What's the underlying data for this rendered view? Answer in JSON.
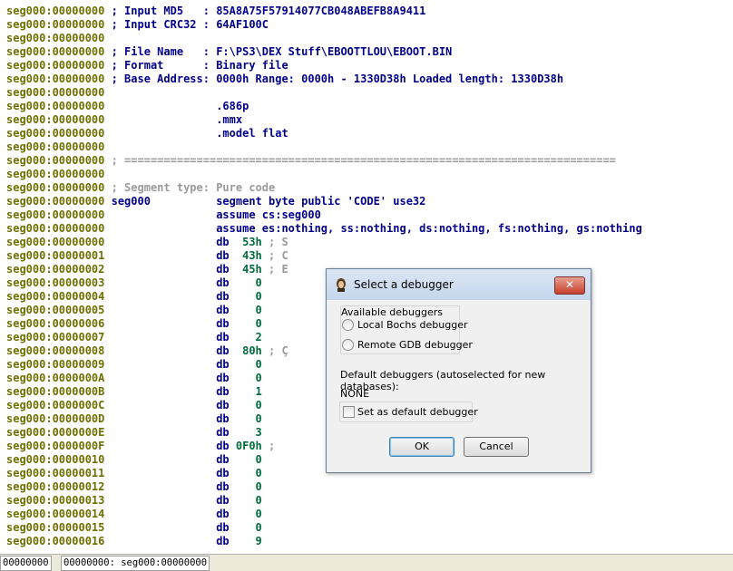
{
  "listing": {
    "lines": [
      {
        "addr": "seg000:00000000",
        "parts": [
          {
            "t": " ; Input MD5   : 85A8A75F57914077CB048ABEFB8A9411",
            "c": "navy"
          }
        ]
      },
      {
        "addr": "seg000:00000000",
        "parts": [
          {
            "t": " ; Input CRC32 : 64AF100C",
            "c": "navy"
          }
        ]
      },
      {
        "addr": "seg000:00000000",
        "parts": []
      },
      {
        "addr": "seg000:00000000",
        "parts": [
          {
            "t": " ; File Name   : F:\\PS3\\DEX Stuff\\EBOOTTLOU\\EBOOT.BIN",
            "c": "navy"
          }
        ]
      },
      {
        "addr": "seg000:00000000",
        "parts": [
          {
            "t": " ; Format      : Binary file",
            "c": "navy"
          }
        ]
      },
      {
        "addr": "seg000:00000000",
        "parts": [
          {
            "t": " ; Base Address: 0000h Range: 0000h - 1330D38h Loaded length: 1330D38h",
            "c": "navy"
          }
        ]
      },
      {
        "addr": "seg000:00000000",
        "parts": []
      },
      {
        "addr": "seg000:00000000",
        "parts": [
          {
            "t": "                 .686p",
            "c": "navy"
          }
        ]
      },
      {
        "addr": "seg000:00000000",
        "parts": [
          {
            "t": "                 .mmx",
            "c": "navy"
          }
        ]
      },
      {
        "addr": "seg000:00000000",
        "parts": [
          {
            "t": "                 .model flat",
            "c": "navy"
          }
        ]
      },
      {
        "addr": "seg000:00000000",
        "parts": []
      },
      {
        "addr": "seg000:00000000",
        "parts": [
          {
            "t": " ; ===========================================================================",
            "c": "grey"
          }
        ]
      },
      {
        "addr": "seg000:00000000",
        "parts": []
      },
      {
        "addr": "seg000:00000000",
        "parts": [
          {
            "t": " ; Segment type: Pure code",
            "c": "grey"
          }
        ]
      },
      {
        "addr": "seg000:00000000",
        "parts": [
          {
            "t": " seg000          segment byte public 'CODE' use32",
            "c": "navy"
          }
        ]
      },
      {
        "addr": "seg000:00000000",
        "parts": [
          {
            "t": "                 assume cs:seg000",
            "c": "navy"
          }
        ]
      },
      {
        "addr": "seg000:00000000",
        "parts": [
          {
            "t": "                 assume es:nothing, ss:nothing, ds:nothing, fs:nothing, gs:nothing",
            "c": "navy"
          }
        ]
      },
      {
        "addr": "seg000:00000000",
        "parts": [
          {
            "t": "                 db  ",
            "c": "navy"
          },
          {
            "t": "53h",
            "c": "green"
          },
          {
            "t": " ; S",
            "c": "grey"
          }
        ]
      },
      {
        "addr": "seg000:00000001",
        "parts": [
          {
            "t": "                 db  ",
            "c": "navy"
          },
          {
            "t": "43h",
            "c": "green"
          },
          {
            "t": " ; C",
            "c": "grey"
          }
        ]
      },
      {
        "addr": "seg000:00000002",
        "parts": [
          {
            "t": "                 db  ",
            "c": "navy"
          },
          {
            "t": "45h",
            "c": "green"
          },
          {
            "t": " ; E",
            "c": "grey"
          }
        ]
      },
      {
        "addr": "seg000:00000003",
        "parts": [
          {
            "t": "                 db    ",
            "c": "navy"
          },
          {
            "t": "0",
            "c": "green"
          }
        ]
      },
      {
        "addr": "seg000:00000004",
        "parts": [
          {
            "t": "                 db    ",
            "c": "navy"
          },
          {
            "t": "0",
            "c": "green"
          }
        ]
      },
      {
        "addr": "seg000:00000005",
        "parts": [
          {
            "t": "                 db    ",
            "c": "navy"
          },
          {
            "t": "0",
            "c": "green"
          }
        ]
      },
      {
        "addr": "seg000:00000006",
        "parts": [
          {
            "t": "                 db    ",
            "c": "navy"
          },
          {
            "t": "0",
            "c": "green"
          }
        ]
      },
      {
        "addr": "seg000:00000007",
        "parts": [
          {
            "t": "                 db    ",
            "c": "navy"
          },
          {
            "t": "2",
            "c": "green"
          }
        ]
      },
      {
        "addr": "seg000:00000008",
        "parts": [
          {
            "t": "                 db  ",
            "c": "navy"
          },
          {
            "t": "80h",
            "c": "green"
          },
          {
            "t": " ; Ç",
            "c": "grey"
          }
        ]
      },
      {
        "addr": "seg000:00000009",
        "parts": [
          {
            "t": "                 db    ",
            "c": "navy"
          },
          {
            "t": "0",
            "c": "green"
          }
        ]
      },
      {
        "addr": "seg000:0000000A",
        "parts": [
          {
            "t": "                 db    ",
            "c": "navy"
          },
          {
            "t": "0",
            "c": "green"
          }
        ]
      },
      {
        "addr": "seg000:0000000B",
        "parts": [
          {
            "t": "                 db    ",
            "c": "navy"
          },
          {
            "t": "1",
            "c": "green"
          }
        ]
      },
      {
        "addr": "seg000:0000000C",
        "parts": [
          {
            "t": "                 db    ",
            "c": "navy"
          },
          {
            "t": "0",
            "c": "green"
          }
        ]
      },
      {
        "addr": "seg000:0000000D",
        "parts": [
          {
            "t": "                 db    ",
            "c": "navy"
          },
          {
            "t": "0",
            "c": "green"
          }
        ]
      },
      {
        "addr": "seg000:0000000E",
        "parts": [
          {
            "t": "                 db    ",
            "c": "navy"
          },
          {
            "t": "3",
            "c": "green"
          }
        ]
      },
      {
        "addr": "seg000:0000000F",
        "parts": [
          {
            "t": "                 db ",
            "c": "navy"
          },
          {
            "t": "0F0h",
            "c": "green"
          },
          {
            "t": " ;",
            "c": "grey"
          }
        ]
      },
      {
        "addr": "seg000:00000010",
        "parts": [
          {
            "t": "                 db    ",
            "c": "navy"
          },
          {
            "t": "0",
            "c": "green"
          }
        ]
      },
      {
        "addr": "seg000:00000011",
        "parts": [
          {
            "t": "                 db    ",
            "c": "navy"
          },
          {
            "t": "0",
            "c": "green"
          }
        ]
      },
      {
        "addr": "seg000:00000012",
        "parts": [
          {
            "t": "                 db    ",
            "c": "navy"
          },
          {
            "t": "0",
            "c": "green"
          }
        ]
      },
      {
        "addr": "seg000:00000013",
        "parts": [
          {
            "t": "                 db    ",
            "c": "navy"
          },
          {
            "t": "0",
            "c": "green"
          }
        ]
      },
      {
        "addr": "seg000:00000014",
        "parts": [
          {
            "t": "                 db    ",
            "c": "navy"
          },
          {
            "t": "0",
            "c": "green"
          }
        ]
      },
      {
        "addr": "seg000:00000015",
        "parts": [
          {
            "t": "                 db    ",
            "c": "navy"
          },
          {
            "t": "0",
            "c": "green"
          }
        ]
      },
      {
        "addr": "seg000:00000016",
        "parts": [
          {
            "t": "                 db    ",
            "c": "navy"
          },
          {
            "t": "9",
            "c": "green"
          }
        ]
      }
    ]
  },
  "statusbar": {
    "offset": "00000000",
    "location": "00000000: seg000:00000000"
  },
  "dialog": {
    "title": "Select a debugger",
    "close_label": "✕",
    "available_label": "Available debuggers",
    "options": [
      {
        "label": "Local Bochs debugger",
        "selected": false
      },
      {
        "label": "Remote GDB debugger",
        "selected": false
      }
    ],
    "default_label": "Default debuggers (autoselected for new databases):",
    "default_value": "NONE",
    "set_default_label": "Set as default debugger",
    "set_default_checked": false,
    "ok_label": "OK",
    "cancel_label": "Cancel"
  },
  "colors": {
    "address": "#6f6f00",
    "instruction": "#00008b",
    "number": "#006b3c",
    "comment": "#9a9a9a",
    "close_button": "#c7402c"
  }
}
